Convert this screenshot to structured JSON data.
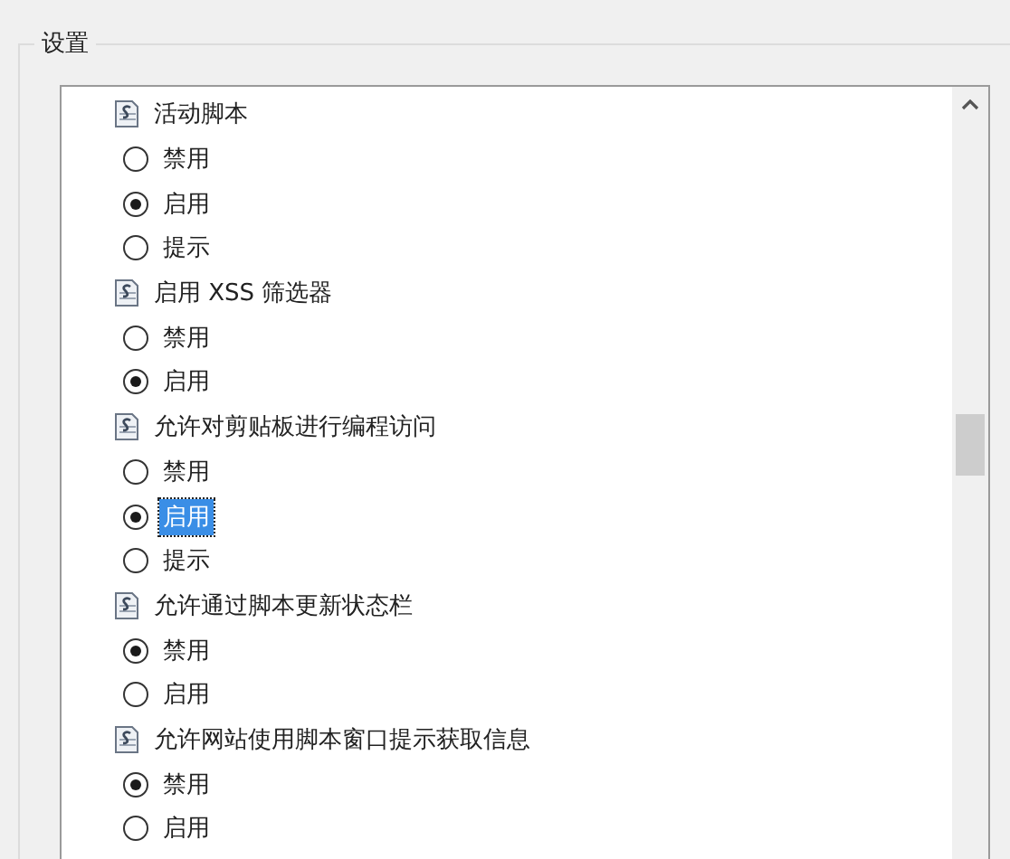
{
  "group": {
    "title": "设置"
  },
  "settings": [
    {
      "label": "活动脚本",
      "options": [
        {
          "label": "禁用",
          "selected": false,
          "focused": false
        },
        {
          "label": "启用",
          "selected": true,
          "focused": false
        },
        {
          "label": "提示",
          "selected": false,
          "focused": false
        }
      ]
    },
    {
      "label": "启用 XSS 筛选器",
      "options": [
        {
          "label": "禁用",
          "selected": false,
          "focused": false
        },
        {
          "label": "启用",
          "selected": true,
          "focused": false
        }
      ]
    },
    {
      "label": "允许对剪贴板进行编程访问",
      "options": [
        {
          "label": "禁用",
          "selected": false,
          "focused": false
        },
        {
          "label": "启用",
          "selected": true,
          "focused": true
        },
        {
          "label": "提示",
          "selected": false,
          "focused": false
        }
      ]
    },
    {
      "label": "允许通过脚本更新状态栏",
      "options": [
        {
          "label": "禁用",
          "selected": true,
          "focused": false
        },
        {
          "label": "启用",
          "selected": false,
          "focused": false
        }
      ]
    },
    {
      "label": "允许网站使用脚本窗口提示获取信息",
      "options": [
        {
          "label": "禁用",
          "selected": true,
          "focused": false
        },
        {
          "label": "启用",
          "selected": false,
          "focused": false
        }
      ]
    }
  ]
}
